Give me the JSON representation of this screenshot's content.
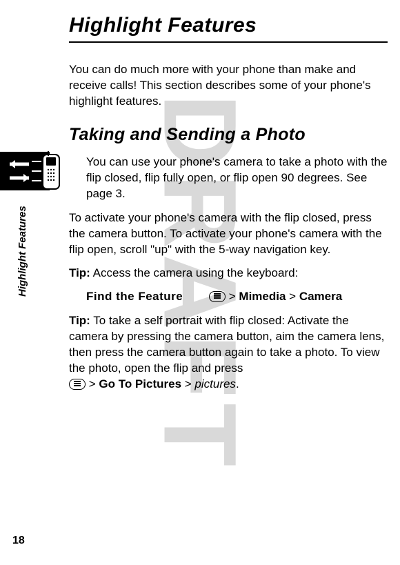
{
  "watermark": "DRAFT",
  "title": "Highlight Features",
  "intro": "You can do much more with your phone than make and receive calls! This section describes some of your phone's highlight features.",
  "section": {
    "heading": "Taking and Sending a Photo",
    "intro": "You can use your phone's camera to take a photo with the flip closed, flip fully open, or flip open 90 degrees. See page 3.",
    "activate": "To activate your phone's camera with the flip closed, press the camera button. To activate your phone's camera with the flip open, scroll \"up\" with the 5-way navigation key.",
    "tip1_label": "Tip:",
    "tip1_text": " Access the camera using the keyboard:",
    "find_label": "Find the Feature",
    "path_sep": " > ",
    "path_mimedia": "Mimedia",
    "path_camera": "Camera",
    "tip2_label": "Tip:",
    "tip2_text": " To take a self portrait with flip closed: Activate the camera by pressing the camera button, aim the camera lens, then press the camera button again to take a photo. To view the photo, open the flip and press",
    "path_gotopictures": "Go To Pictures",
    "path_pictures": "pictures",
    "period": "."
  },
  "side_label": "Highlight Features",
  "page_number": "18"
}
